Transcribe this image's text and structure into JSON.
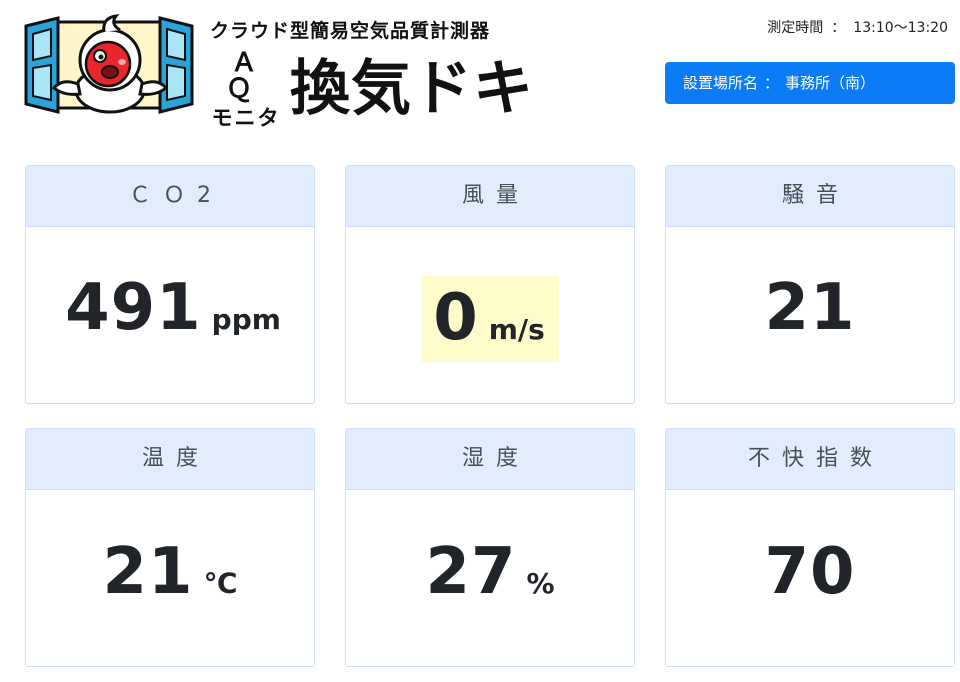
{
  "header": {
    "tagline": "クラウド型簡易空気品質計測器",
    "sub_aq": "ＡＱ",
    "sub_monitor": "モニタ",
    "brand": "換気ドキ",
    "time_label": "測定時間",
    "time_sep": "：",
    "time_value": "13:10〜13:20",
    "location_label": "設置場所名",
    "location_sep": "：",
    "location_value": "事務所（南）"
  },
  "metrics": [
    {
      "label": "ＣＯ2",
      "value": "491",
      "unit": "ppm",
      "highlight": false
    },
    {
      "label": "風量",
      "value": "0",
      "unit": "m/s",
      "highlight": true
    },
    {
      "label": "騒音",
      "value": "21",
      "unit": "",
      "highlight": false
    },
    {
      "label": "温度",
      "value": "21",
      "unit": "℃",
      "highlight": false
    },
    {
      "label": "湿度",
      "value": "27",
      "unit": "%",
      "highlight": false
    },
    {
      "label": "不快指数",
      "value": "70",
      "unit": "",
      "highlight": false
    }
  ],
  "colors": {
    "accent": "#0b7cf5",
    "card_header_bg": "#e1edfc",
    "highlight_bg": "#fffccc",
    "window_frame": "#2aa4d8",
    "mascot_red": "#e8262b"
  },
  "icons": {
    "logo": "mascot-in-window-logo"
  }
}
